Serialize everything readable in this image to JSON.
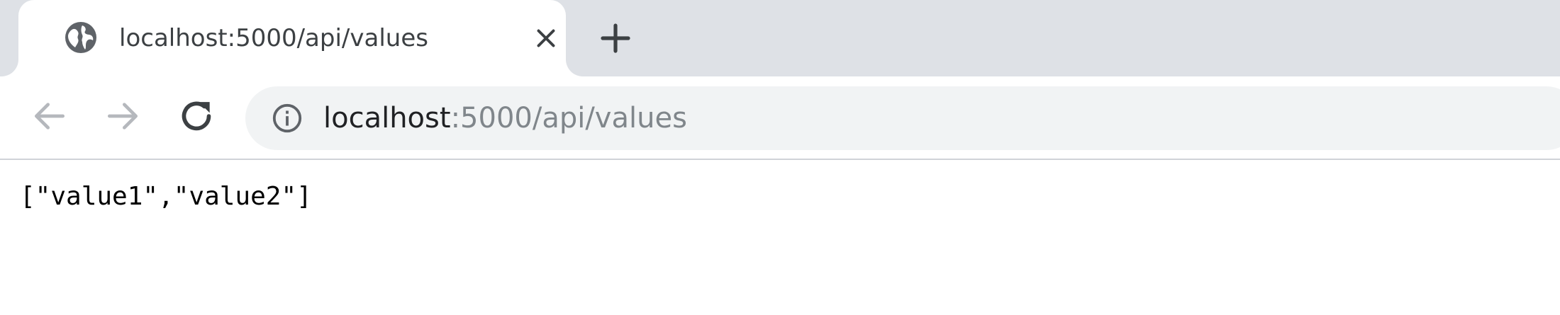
{
  "tab": {
    "title": "localhost:5000/api/values",
    "favicon": "globe-icon",
    "close_icon": "close-icon"
  },
  "new_tab_icon": "plus-icon",
  "toolbar": {
    "back_icon": "arrow-left-icon",
    "forward_icon": "arrow-right-icon",
    "reload_icon": "reload-icon",
    "info_icon": "info-icon"
  },
  "address_bar": {
    "host": "localhost",
    "rest": ":5000/api/values"
  },
  "page": {
    "body_text": "[\"value1\",\"value2\"]"
  },
  "colors": {
    "tabstrip_bg": "#dee1e6",
    "omnibox_bg": "#f1f3f4",
    "url_host": "#202124",
    "url_rest": "#80868b"
  }
}
